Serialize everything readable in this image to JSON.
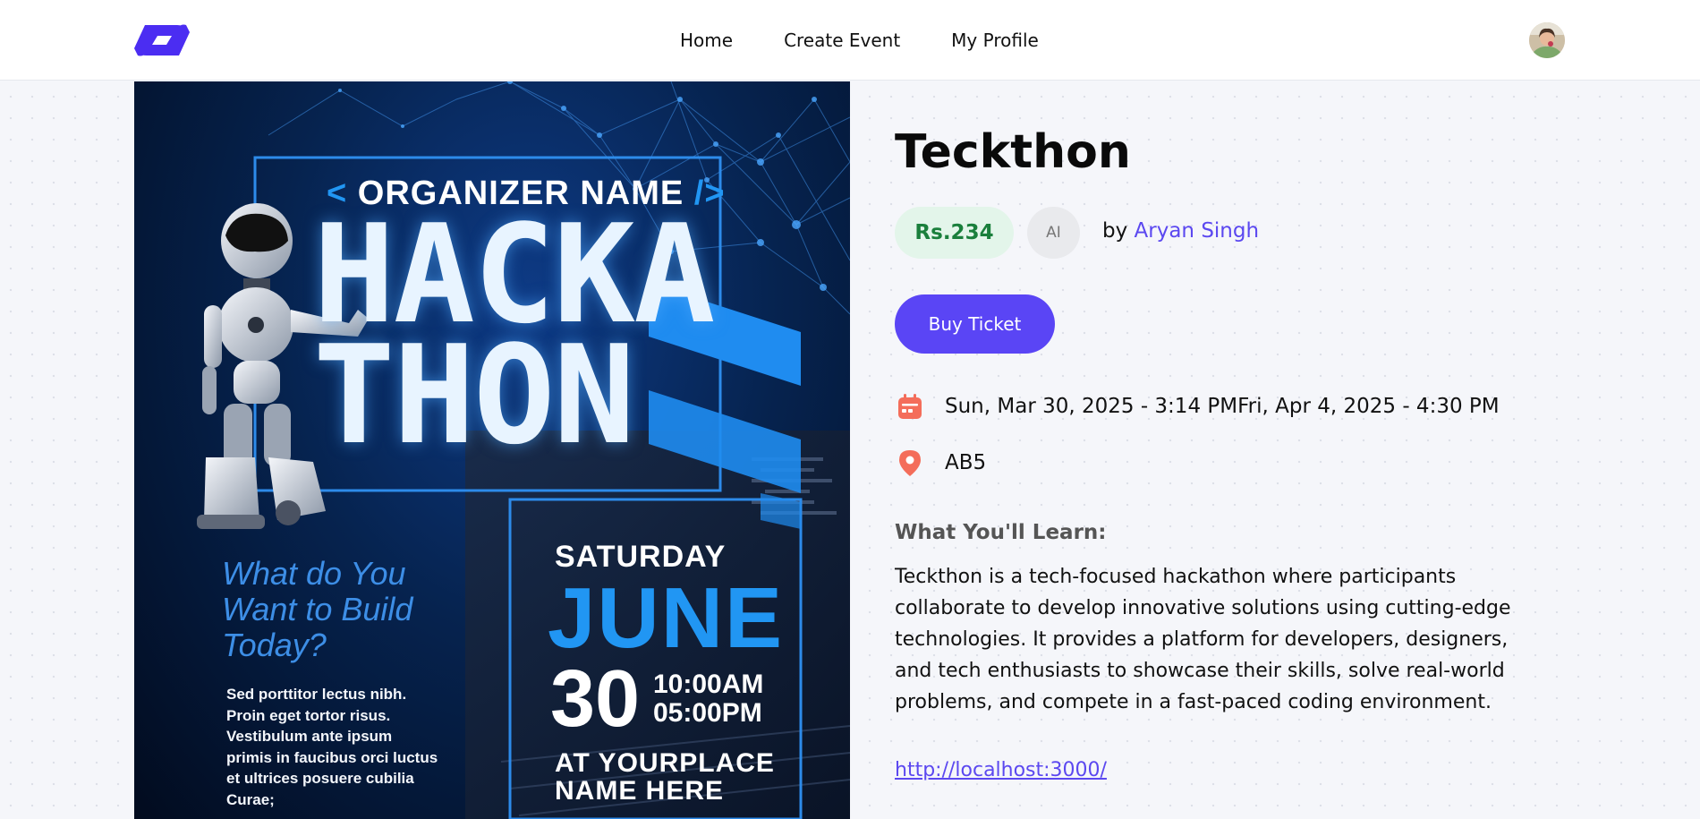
{
  "nav": {
    "links": [
      "Home",
      "Create Event",
      "My Profile"
    ]
  },
  "poster": {
    "organizer": "ORGANIZER NAME",
    "bracket_open": "<",
    "bracket_close": "/>",
    "title_line1": "HACKA",
    "title_line2": "THON",
    "question": "What do You Want to Build Today?",
    "lorem": "Sed porttitor lectus nibh. Proin eget tortor risus. Vestibulum ante ipsum primis in faucibus orci luctus et ultrices posuere cubilia Curae;",
    "day": "SATURDAY",
    "month": "JUNE",
    "date": "30",
    "time_start": "10:00AM",
    "time_end": "05:00PM",
    "place_line1": "AT YOURPLACE",
    "place_line2": "NAME HERE"
  },
  "event": {
    "title": "Teckthon",
    "price": "Rs.234",
    "category": "AI",
    "by_label": "by",
    "organizer": "Aryan Singh",
    "buy_label": "Buy Ticket",
    "datetime": "Sun, Mar 30, 2025 - 3:14 PMFri, Apr 4, 2025 - 4:30 PM",
    "location": "AB5",
    "learn_heading": "What You'll Learn:",
    "description": "Teckthon is a tech-focused hackathon where participants collaborate to develop innovative solutions using cutting-edge technologies. It provides a platform for developers, designers, and tech enthusiasts to showcase their skills, solve real-world problems, and compete in a fast-paced coding environment.",
    "url": "http://localhost:3000/"
  },
  "colors": {
    "accent": "#5a45f5",
    "price_bg": "#e3f5ea",
    "price_text": "#1a7f3c",
    "icon_coral": "#f46d5a"
  },
  "icons": {
    "logo": "evently-logo",
    "date": "calendar-icon",
    "location": "location-pin-icon"
  }
}
